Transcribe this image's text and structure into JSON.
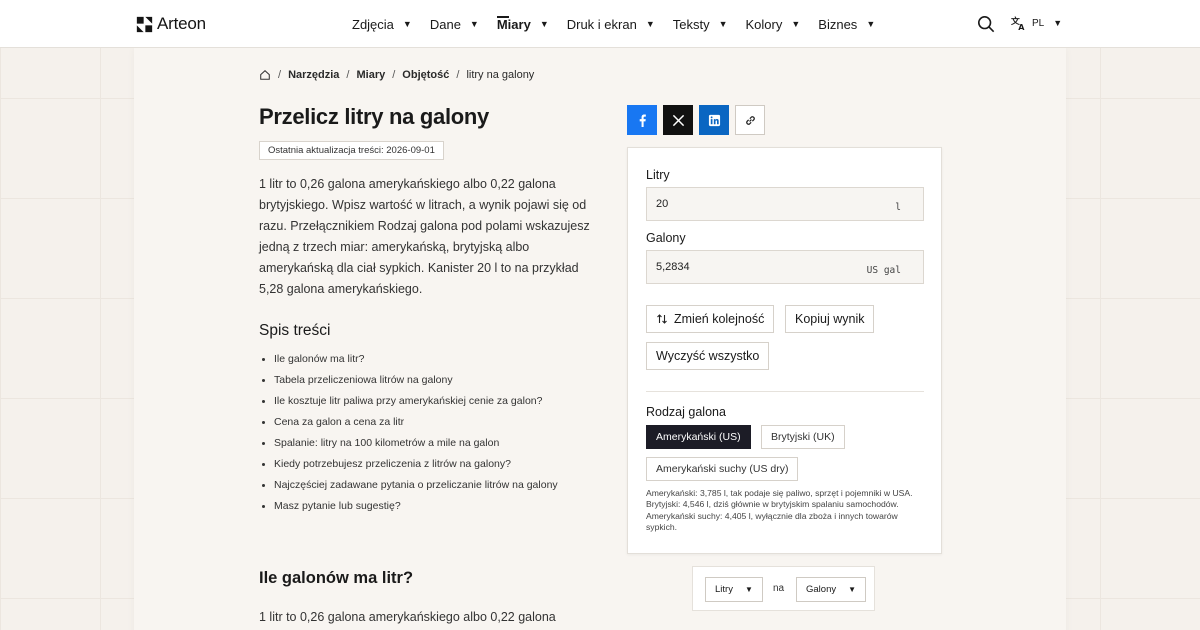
{
  "header": {
    "brand": "Arteon",
    "nav": [
      {
        "label": "Zdjęcia",
        "active": false
      },
      {
        "label": "Dane",
        "active": false
      },
      {
        "label": "Miary",
        "active": true
      },
      {
        "label": "Druk i ekran",
        "active": false
      },
      {
        "label": "Teksty",
        "active": false
      },
      {
        "label": "Kolory",
        "active": false
      },
      {
        "label": "Biznes",
        "active": false
      }
    ],
    "lang": "PL"
  },
  "breadcrumb": [
    "Narzędzia",
    "Miary",
    "Objętość",
    "litry na galony"
  ],
  "page": {
    "title": "Przelicz litry na galony",
    "updated": "Ostatnia aktualizacja treści: 2026-09-01",
    "intro": "1 litr to 0,26 galona amerykańskiego albo 0,22 galona brytyjskiego. Wpisz wartość w litrach, a wynik pojawi się od razu. Przełącznikiem Rodzaj galona pod polami wskazujesz jedną z trzech miar: amerykańską, brytyjską albo amerykańską dla ciał sypkich. Kanister 20 l to na przykład 5,28 galona amerykańskiego.",
    "toc_title": "Spis treści",
    "toc": [
      "Ile galonów ma litr?",
      "Tabela przeliczeniowa litrów na galony",
      "Ile kosztuje litr paliwa przy amerykańskiej cenie za galon?",
      "Cena za galon a cena za litr",
      "Spalanie: litry na 100 kilometrów a mile na galon",
      "Kiedy potrzebujesz przeliczenia z litrów na galony?",
      "Najczęściej zadawane pytania o przeliczanie litrów na galony",
      "Masz pytanie lub sugestię?"
    ],
    "section_title": "Ile galonów ma litr?",
    "section_text": "1 litr to 0,26 galona amerykańskiego albo 0,22 galona"
  },
  "converter": {
    "from_label": "Litry",
    "from_value": "20",
    "from_unit": "l",
    "to_label": "Galony",
    "to_value": "5,2834",
    "to_unit": "US gal",
    "swap_label": "Zmień kolejność",
    "copy_label": "Kopiuj wynik",
    "clear_label": "Wyczyść wszystko",
    "type_label": "Rodzaj galona",
    "types": [
      "Amerykański (US)",
      "Brytyjski (UK)",
      "Amerykański suchy (US dry)"
    ],
    "selected_type": "Amerykański (US)",
    "note": "Amerykański: 3,785 l, tak podaje się paliwo, sprzęt i pojemniki w USA. Brytyjski: 4,546 l, dziś głównie w brytyjskim spalaniu samochodów. Amerykański suchy: 4,405 l, wyłącznie dla zboża i innych towarów sypkich."
  },
  "picker": {
    "from": "Litry",
    "connector": "na",
    "to": "Galony"
  },
  "colors": {
    "facebook": "#1877f2",
    "x": "#111111",
    "linkedin": "#0a66c2",
    "selected_pill": "#1c1c26"
  }
}
